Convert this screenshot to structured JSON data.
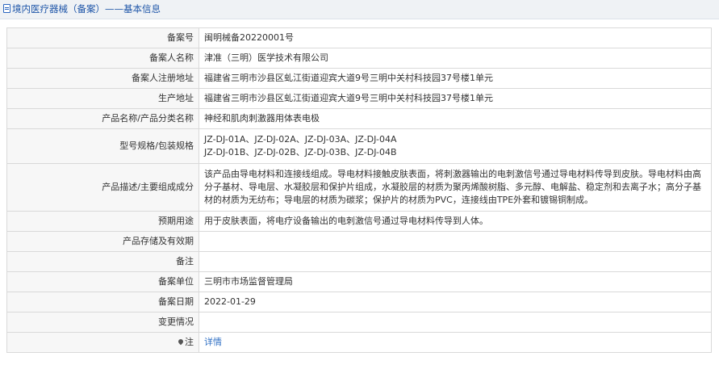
{
  "header": {
    "title": "境内医疗器械（备案）——基本信息",
    "icon": "document-icon",
    "title_color": "#1e55a8"
  },
  "rows": {
    "record_no": {
      "label": "备案号",
      "value": "闽明械备20220001号"
    },
    "registrant": {
      "label": "备案人名称",
      "value": "津准（三明）医学技术有限公司"
    },
    "registrant_address": {
      "label": "备案人注册地址",
      "value": "福建省三明市沙县区虬江街道迎宾大道9号三明中关村科技园37号楼1单元"
    },
    "production_address": {
      "label": "生产地址",
      "value": "福建省三明市沙县区虬江街道迎宾大道9号三明中关村科技园37号楼1单元"
    },
    "product_name": {
      "label": "产品名称/产品分类名称",
      "value": "神经和肌肉刺激器用体表电极"
    },
    "model_spec": {
      "label": "型号规格/包装规格",
      "lines": [
        "JZ-DJ-01A、JZ-DJ-02A、JZ-DJ-03A、JZ-DJ-04A",
        "JZ-DJ-01B、JZ-DJ-02B、JZ-DJ-03B、JZ-DJ-04B"
      ]
    },
    "description": {
      "label": "产品描述/主要组成成分",
      "value": "该产品由导电材料和连接线组成。导电材料接触皮肤表面，将刺激器输出的电刺激信号通过导电材料传导到皮肤。导电材料由高分子基材、导电层、水凝胶层和保护片组成，水凝胶层的材质为聚丙烯酸树脂、多元醇、电解盐、稳定剂和去离子水；高分子基材的材质为无纺布；导电层的材质为碳浆；保护片的材质为PVC，连接线由TPE外套和镀锡铜制成。"
    },
    "intended_use": {
      "label": "预期用途",
      "value": "用于皮肤表面，将电疗设备输出的电刺激信号通过导电材料传导到人体。"
    },
    "storage": {
      "label": "产品存储及有效期",
      "value": ""
    },
    "remarks": {
      "label": "备注",
      "value": ""
    },
    "authority": {
      "label": "备案单位",
      "value": "三明市市场监督管理局"
    },
    "record_date": {
      "label": "备案日期",
      "value": "2022-01-29"
    },
    "changes": {
      "label": "变更情况",
      "value": ""
    },
    "note": {
      "label": "注",
      "icon": "pin-icon",
      "link_text": "详情",
      "link_color": "#2f6fc4"
    }
  }
}
